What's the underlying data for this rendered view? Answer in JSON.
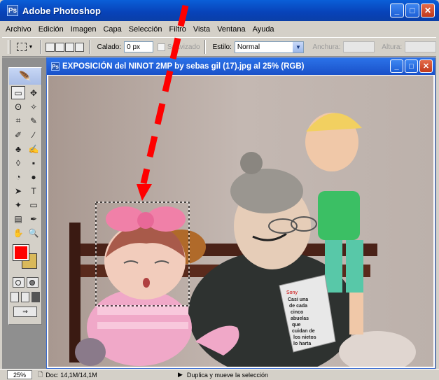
{
  "app": {
    "title": "Adobe Photoshop",
    "logo_text": "Ps"
  },
  "window_buttons": {
    "minimize": "_",
    "maximize": "□",
    "close": "✕"
  },
  "menu": [
    "Archivo",
    "Edición",
    "Imagen",
    "Capa",
    "Selección",
    "Filtro",
    "Vista",
    "Ventana",
    "Ayuda"
  ],
  "options": {
    "feather_label": "Calado:",
    "feather_value": "0 px",
    "antialias_label": "Suavizado",
    "style_label": "Estilo:",
    "style_value": "Normal",
    "width_label": "Anchura:",
    "height_label": "Altura:"
  },
  "document": {
    "title": "EXPOSICIÓN  del NINOT 2MP by sebas gil (17).jpg al 25% (RGB)"
  },
  "toolbox": {
    "tools": [
      "▭",
      "✥",
      "ʘ",
      "✧",
      "⌗",
      "✎",
      "✐",
      "∕",
      "♣",
      "✍",
      "◊",
      "▪",
      "◔",
      "●",
      "➤",
      "T",
      "✦",
      "▭",
      "▤",
      "✒",
      "✋",
      "🔍"
    ],
    "fg_color": "#ff0000",
    "bg_color": "#d9b95a"
  },
  "book": {
    "brand": "Sony",
    "lines": [
      "Casi una",
      "de cada",
      "cinco",
      "abuelas",
      "que",
      "cuidan de",
      "los nietos",
      "lo harta"
    ]
  },
  "status": {
    "zoom": "25%",
    "doc_size": "Doc: 14,1M/14,1M",
    "message": "Duplica y mueve la selección"
  },
  "colors": {
    "annotation": "#ff0000",
    "titlebar": "#0a4fd0"
  }
}
